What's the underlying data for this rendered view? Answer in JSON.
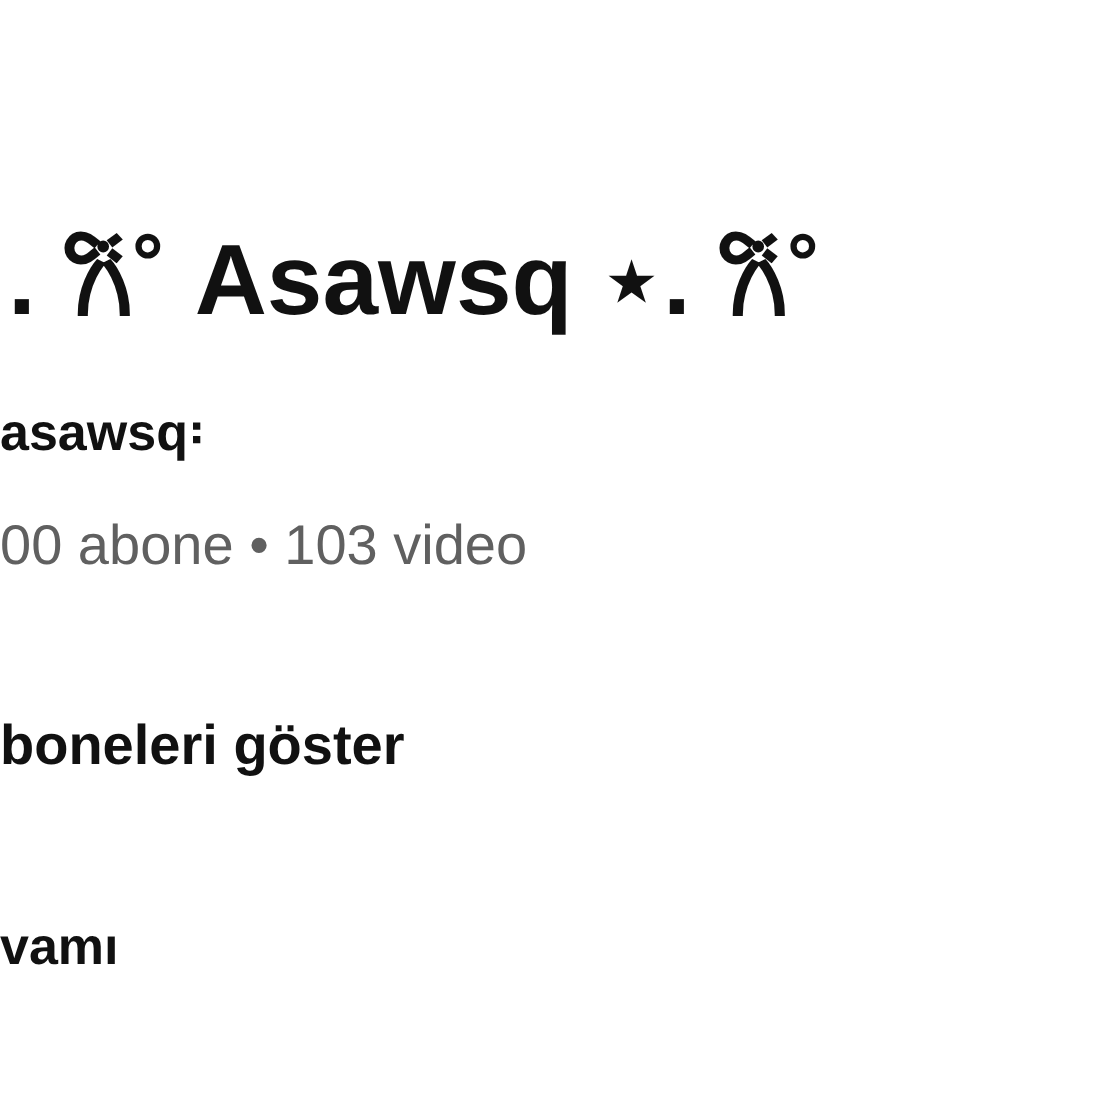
{
  "channel_name": ". 𐙚˚ Asawsq ⋆. 𐙚˚",
  "handle": "asawsq꞉",
  "stats": "00 abone • 103 video",
  "show_subscribers": "boneleri göster",
  "more": "vamı"
}
